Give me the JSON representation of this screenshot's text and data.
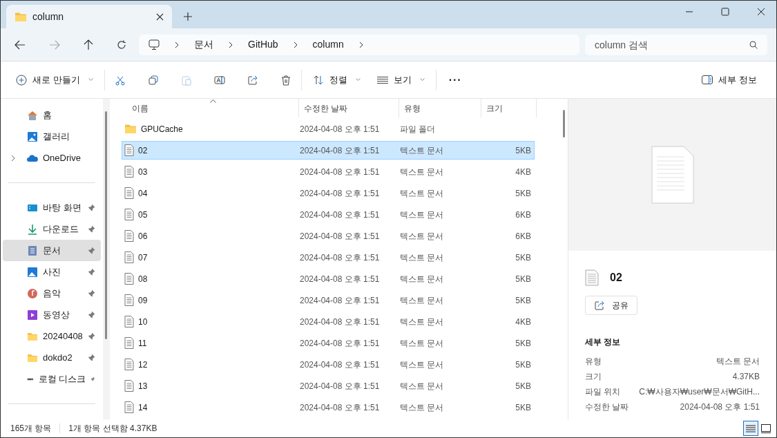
{
  "tab": {
    "title": "column",
    "selected": true
  },
  "breadcrumb": [
    "문서",
    "GitHub",
    "column"
  ],
  "search": {
    "placeholder": "column 검색"
  },
  "toolbar": {
    "new": "새로 만들기",
    "sort": "정렬",
    "view": "보기",
    "more": "···",
    "details": "세부 정보"
  },
  "sidebar": {
    "sections": [
      [
        {
          "label": "홈",
          "kind": "home",
          "pinned": false,
          "selected": false
        },
        {
          "label": "갤러리",
          "kind": "gallery",
          "pinned": false,
          "selected": false
        },
        {
          "label": "OneDrive",
          "kind": "cloud",
          "pinned": false,
          "selected": false,
          "expandable": true
        }
      ],
      [
        {
          "label": "바탕 화면",
          "kind": "desktop",
          "pinned": true,
          "selected": false
        },
        {
          "label": "다운로드",
          "kind": "download",
          "pinned": true,
          "selected": false
        },
        {
          "label": "문서",
          "kind": "documents",
          "pinned": true,
          "selected": true
        },
        {
          "label": "사진",
          "kind": "pictures",
          "pinned": true,
          "selected": false
        },
        {
          "label": "음악",
          "kind": "music",
          "pinned": true,
          "selected": false
        },
        {
          "label": "동영상",
          "kind": "video",
          "pinned": true,
          "selected": false
        },
        {
          "label": "20240408",
          "kind": "folder",
          "pinned": true,
          "selected": false
        },
        {
          "label": "dokdo2",
          "kind": "folder",
          "pinned": true,
          "selected": false
        },
        {
          "label": "로컬 디스크",
          "kind": "drive",
          "pinned": true,
          "selected": false
        }
      ]
    ]
  },
  "table": {
    "columns": [
      "이름",
      "수정한 날짜",
      "유형",
      "크기"
    ],
    "rows": [
      {
        "name": "GPUCache",
        "date": "2024-04-08 오후 1:51",
        "type": "파일 폴더",
        "kind": "folder",
        "selected": false
      },
      {
        "name": "02",
        "date": "2024-04-08 오후 1:51",
        "type": "텍스트 문서",
        "size": "5KB",
        "kind": "text",
        "selected": true
      },
      {
        "name": "03",
        "date": "2024-04-08 오후 1:51",
        "type": "텍스트 문서",
        "size": "4KB",
        "kind": "text",
        "selected": false
      },
      {
        "name": "04",
        "date": "2024-04-08 오후 1:51",
        "type": "텍스트 문서",
        "size": "5KB",
        "kind": "text",
        "selected": false
      },
      {
        "name": "05",
        "date": "2024-04-08 오후 1:51",
        "type": "텍스트 문서",
        "size": "6KB",
        "kind": "text",
        "selected": false
      },
      {
        "name": "06",
        "date": "2024-04-08 오후 1:51",
        "type": "텍스트 문서",
        "size": "6KB",
        "kind": "text",
        "selected": false
      },
      {
        "name": "07",
        "date": "2024-04-08 오후 1:51",
        "type": "텍스트 문서",
        "size": "5KB",
        "kind": "text",
        "selected": false
      },
      {
        "name": "08",
        "date": "2024-04-08 오후 1:51",
        "type": "텍스트 문서",
        "size": "5KB",
        "kind": "text",
        "selected": false
      },
      {
        "name": "09",
        "date": "2024-04-08 오후 1:51",
        "type": "텍스트 문서",
        "size": "5KB",
        "kind": "text",
        "selected": false
      },
      {
        "name": "10",
        "date": "2024-04-08 오후 1:51",
        "type": "텍스트 문서",
        "size": "4KB",
        "kind": "text",
        "selected": false
      },
      {
        "name": "11",
        "date": "2024-04-08 오후 1:51",
        "type": "텍스트 문서",
        "size": "5KB",
        "kind": "text",
        "selected": false
      },
      {
        "name": "12",
        "date": "2024-04-08 오후 1:51",
        "type": "텍스트 문서",
        "size": "5KB",
        "kind": "text",
        "selected": false
      },
      {
        "name": "13",
        "date": "2024-04-08 오후 1:51",
        "type": "텍스트 문서",
        "size": "5KB",
        "kind": "text",
        "selected": false
      },
      {
        "name": "14",
        "date": "2024-04-08 오후 1:51",
        "type": "텍스트 문서",
        "size": "5KB",
        "kind": "text",
        "selected": false
      }
    ]
  },
  "details_pane": {
    "name": "02",
    "share": "공유",
    "heading": "세부 정보",
    "properties": [
      {
        "label": "유형",
        "value": "텍스트 문서"
      },
      {
        "label": "크기",
        "value": "4.37KB"
      },
      {
        "label": "파일 위치",
        "value": "C:₩사용자₩user₩문서₩GitH..."
      },
      {
        "label": "수정한 날짜",
        "value": "2024-04-08 오후 1:51"
      }
    ]
  },
  "status_bar": {
    "count": "165개 항목",
    "selection": "1개 항목 선택함 4.37KB",
    "view_buttons": [
      {
        "kind": "details",
        "selected": true
      },
      {
        "kind": "tiles",
        "selected": false
      }
    ]
  }
}
